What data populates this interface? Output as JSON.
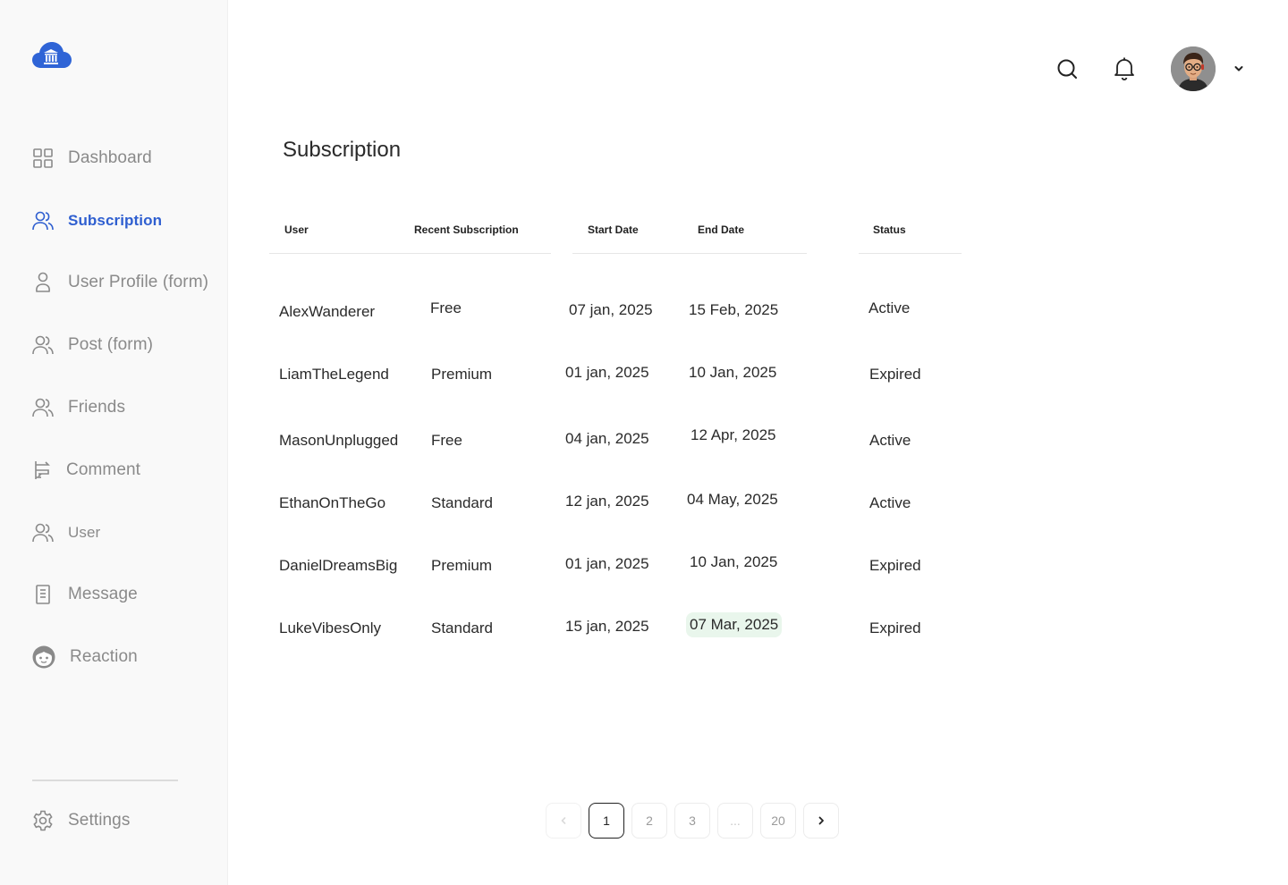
{
  "sidebar": {
    "items": [
      {
        "label": "Dashboard",
        "icon": "grid-icon"
      },
      {
        "label": "Subscription",
        "icon": "users-icon",
        "active": true
      },
      {
        "label": "User Profile (form)",
        "icon": "user-icon"
      },
      {
        "label": "Post (form)",
        "icon": "users-icon"
      },
      {
        "label": "Friends",
        "icon": "users-icon"
      },
      {
        "label": "Comment",
        "icon": "comment-icon"
      },
      {
        "label": "User",
        "icon": "users-icon"
      },
      {
        "label": "Message",
        "icon": "document-icon"
      },
      {
        "label": "Reaction",
        "icon": "face-icon"
      }
    ],
    "settings_label": "Settings"
  },
  "page": {
    "title": "Subscription"
  },
  "table": {
    "columns": [
      "User",
      "Recent Subscription",
      "Start Date",
      "End Date",
      "Status"
    ],
    "rows": [
      {
        "user": "AlexWanderer",
        "plan": "Free",
        "start": "07 jan, 2025",
        "end": "15 Feb, 2025",
        "status": "Active"
      },
      {
        "user": "LiamTheLegend",
        "plan": "Premium",
        "start": "01 jan, 2025",
        "end": "10 Jan, 2025",
        "status": "Expired"
      },
      {
        "user": "MasonUnplugged",
        "plan": "Free",
        "start": "04 jan, 2025",
        "end": "12 Apr, 2025",
        "status": "Active"
      },
      {
        "user": "EthanOnTheGo",
        "plan": "Standard",
        "start": "12 jan, 2025",
        "end": "04 May, 2025",
        "status": "Active"
      },
      {
        "user": "DanielDreamsBig",
        "plan": "Premium",
        "start": "01 jan, 2025",
        "end": "10 Jan, 2025",
        "status": "Expired"
      },
      {
        "user": "LukeVibesOnly",
        "plan": "Standard",
        "start": "15 jan, 2025",
        "end": "07 Mar, 2025",
        "status": "Expired"
      }
    ]
  },
  "pagination": {
    "pages": [
      "1",
      "2",
      "3",
      "...",
      "20"
    ],
    "current": "1"
  },
  "colors": {
    "accent": "#2f5fd0",
    "highlight": "#e9f6ec",
    "sidebar_bg": "#f9f9f9"
  }
}
